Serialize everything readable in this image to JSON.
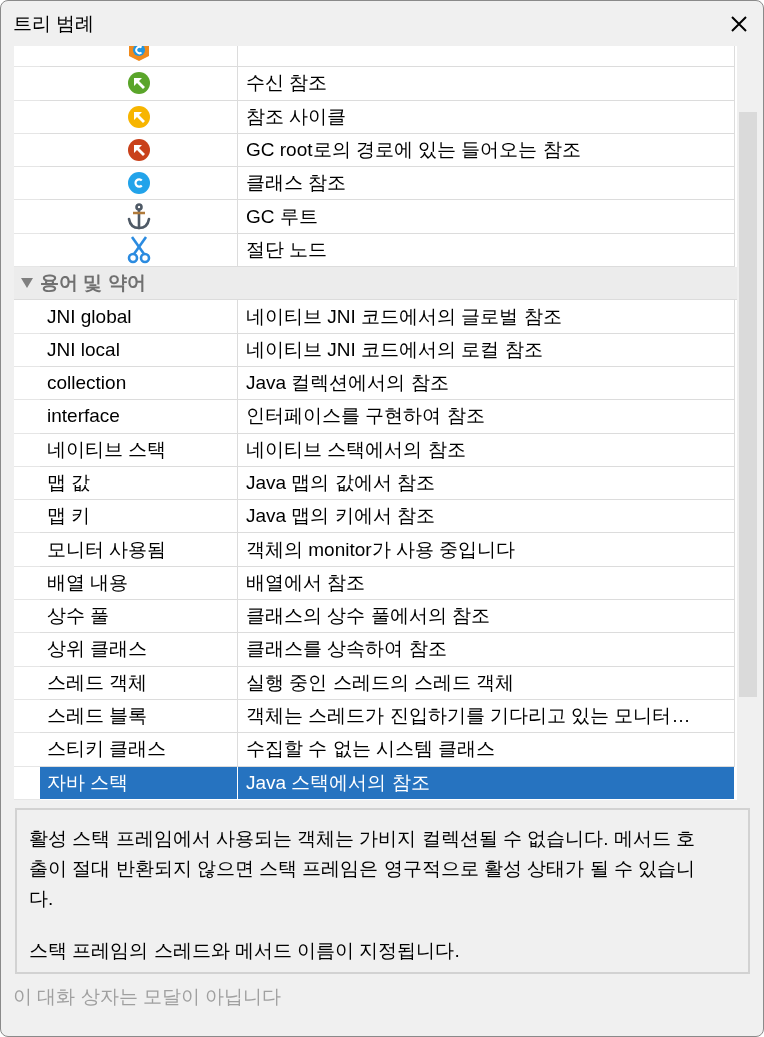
{
  "window": {
    "title": "트리 범례"
  },
  "icon_rows": [
    {
      "kind": "class-hex"
    },
    {
      "kind": "arrow-green",
      "label": "수신 참조"
    },
    {
      "kind": "arrow-yellow",
      "label": "참조 사이클"
    },
    {
      "kind": "arrow-red",
      "label": "GC root로의 경로에 있는 들어오는 참조"
    },
    {
      "kind": "class-circle",
      "label": "클래스 참조"
    },
    {
      "kind": "anchor",
      "label": "GC 루트"
    },
    {
      "kind": "scissors",
      "label": "절단 노드"
    }
  ],
  "section": {
    "label": "용어 및 약어",
    "expanded": true,
    "rows": [
      {
        "term": "JNI global",
        "description": "네이티브 JNI 코드에서의 글로벌 참조",
        "selected": false
      },
      {
        "term": "JNI local",
        "description": "네이티브 JNI 코드에서의 로컬 참조",
        "selected": false
      },
      {
        "term": "collection",
        "description": "Java 컬렉션에서의 참조",
        "selected": false
      },
      {
        "term": "interface",
        "description": "인터페이스를 구현하여 참조",
        "selected": false
      },
      {
        "term": "네이티브 스택",
        "description": "네이티브 스택에서의 참조",
        "selected": false
      },
      {
        "term": "맵 값",
        "description": "Java 맵의 값에서 참조",
        "selected": false
      },
      {
        "term": "맵 키",
        "description": "Java 맵의 키에서 참조",
        "selected": false
      },
      {
        "term": "모니터 사용됨",
        "description": "객체의 monitor가 사용 중입니다",
        "selected": false
      },
      {
        "term": "배열 내용",
        "description": "배열에서 참조",
        "selected": false
      },
      {
        "term": "상수 풀",
        "description": "클래스의 상수 풀에서의 참조",
        "selected": false
      },
      {
        "term": "상위 클래스",
        "description": "클래스를 상속하여 참조",
        "selected": false
      },
      {
        "term": "스레드 객체",
        "description": "실행 중인 스레드의 스레드 객체",
        "selected": false
      },
      {
        "term": "스레드 블록",
        "description": "객체는 스레드가 진입하기를 기다리고 있는 모니터…",
        "selected": false
      },
      {
        "term": "스티키 클래스",
        "description": "수집할 수 없는 시스템 클래스",
        "selected": false
      },
      {
        "term": "자바 스택",
        "description": "Java 스택에서의 참조",
        "selected": true
      }
    ]
  },
  "details": [
    "활성 스택 프레임에서 사용되는 객체는 가비지 컬렉션될 수 없습니다. 메서드 호출이 절대 반환되지 않으면 스택 프레임은 영구적으로 활성 상태가 될 수 있습니다.",
    "스택 프레임의 스레드와 메서드 이름이 지정됩니다."
  ],
  "status": "이 대화 상자는 모달이 아닙니다"
}
